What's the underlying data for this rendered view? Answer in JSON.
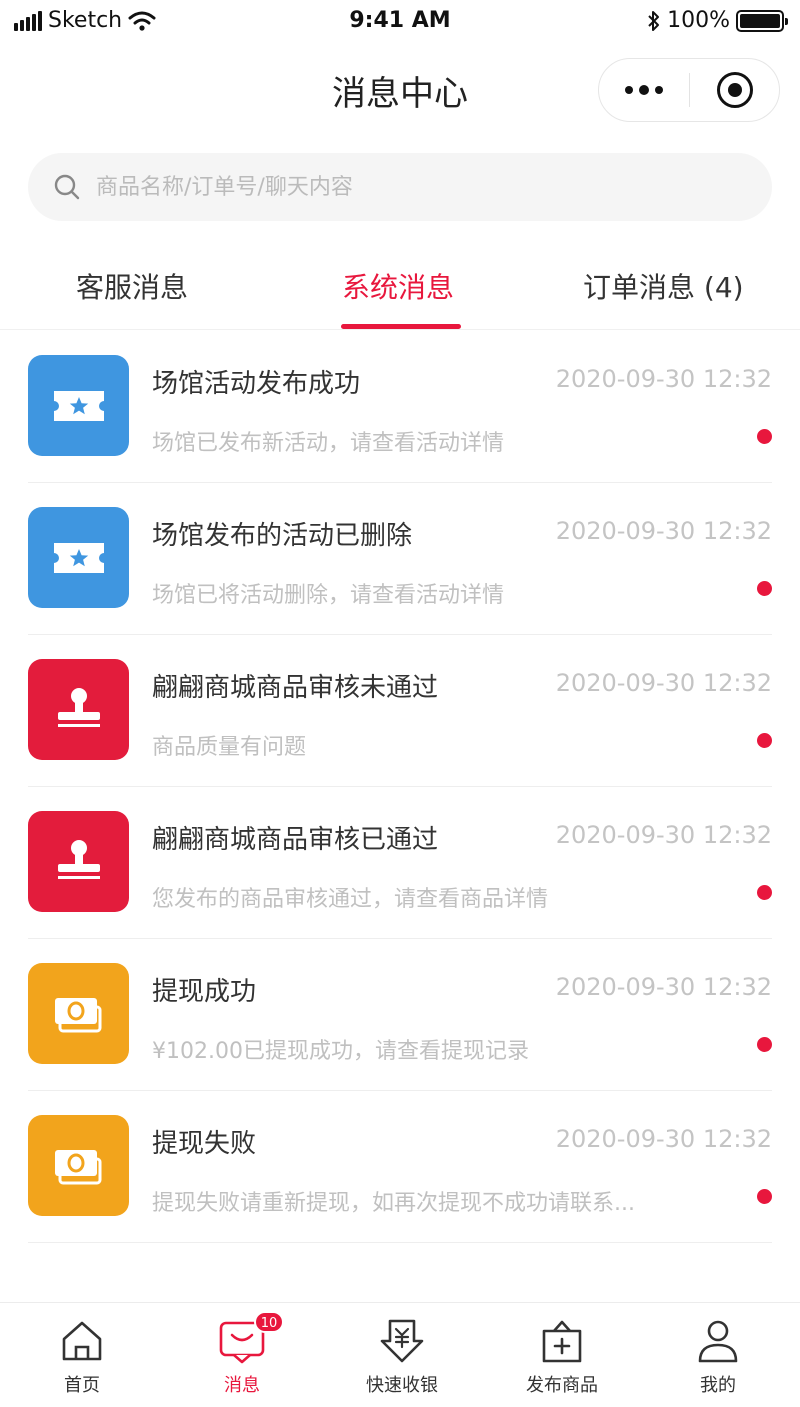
{
  "status_bar": {
    "carrier": "Sketch",
    "time": "9:41 AM",
    "battery": "100%"
  },
  "nav": {
    "title": "消息中心"
  },
  "search": {
    "placeholder": "商品名称/订单号/聊天内容"
  },
  "tabs": [
    {
      "label": "客服消息"
    },
    {
      "label": "系统消息",
      "active": true
    },
    {
      "label": "订单消息 (4)"
    }
  ],
  "messages": [
    {
      "icon": "ticket-icon",
      "color": "#3f96e0",
      "title": "场馆活动发布成功",
      "time": "2020-09-30 12:32",
      "desc": "场馆已发布新活动，请查看活动详情",
      "unread": true
    },
    {
      "icon": "ticket-icon",
      "color": "#3f96e0",
      "title": "场馆发布的活动已删除",
      "time": "2020-09-30 12:32",
      "desc": "场馆已将活动删除，请查看活动详情",
      "unread": true
    },
    {
      "icon": "stamp-icon",
      "color": "#e31c3c",
      "title": "翩翩商城商品审核未通过",
      "time": "2020-09-30 12:32",
      "desc": "商品质量有问题",
      "unread": true
    },
    {
      "icon": "stamp-icon",
      "color": "#e31c3c",
      "title": "翩翩商城商品审核已通过",
      "time": "2020-09-30 12:32",
      "desc": "您发布的商品审核通过，请查看商品详情",
      "unread": true
    },
    {
      "icon": "money-icon",
      "color": "#f2a41c",
      "title": "提现成功",
      "time": "2020-09-30 12:32",
      "desc": "¥102.00已提现成功，请查看提现记录",
      "unread": true
    },
    {
      "icon": "money-icon",
      "color": "#f2a41c",
      "title": "提现失败",
      "time": "2020-09-30 12:32",
      "desc": "提现失败请重新提现，如再次提现不成功请联系...",
      "unread": true
    }
  ],
  "tabbar": {
    "items": [
      {
        "label": "首页",
        "icon": "home-icon"
      },
      {
        "label": "消息",
        "icon": "message-icon",
        "active": true,
        "badge": "10"
      },
      {
        "label": "快速收银",
        "icon": "cashier-icon"
      },
      {
        "label": "发布商品",
        "icon": "publish-icon"
      },
      {
        "label": "我的",
        "icon": "profile-icon"
      }
    ]
  },
  "colors": {
    "accent": "#e8173d",
    "blue": "#3f96e0",
    "red": "#e31c3c",
    "orange": "#f2a41c"
  }
}
